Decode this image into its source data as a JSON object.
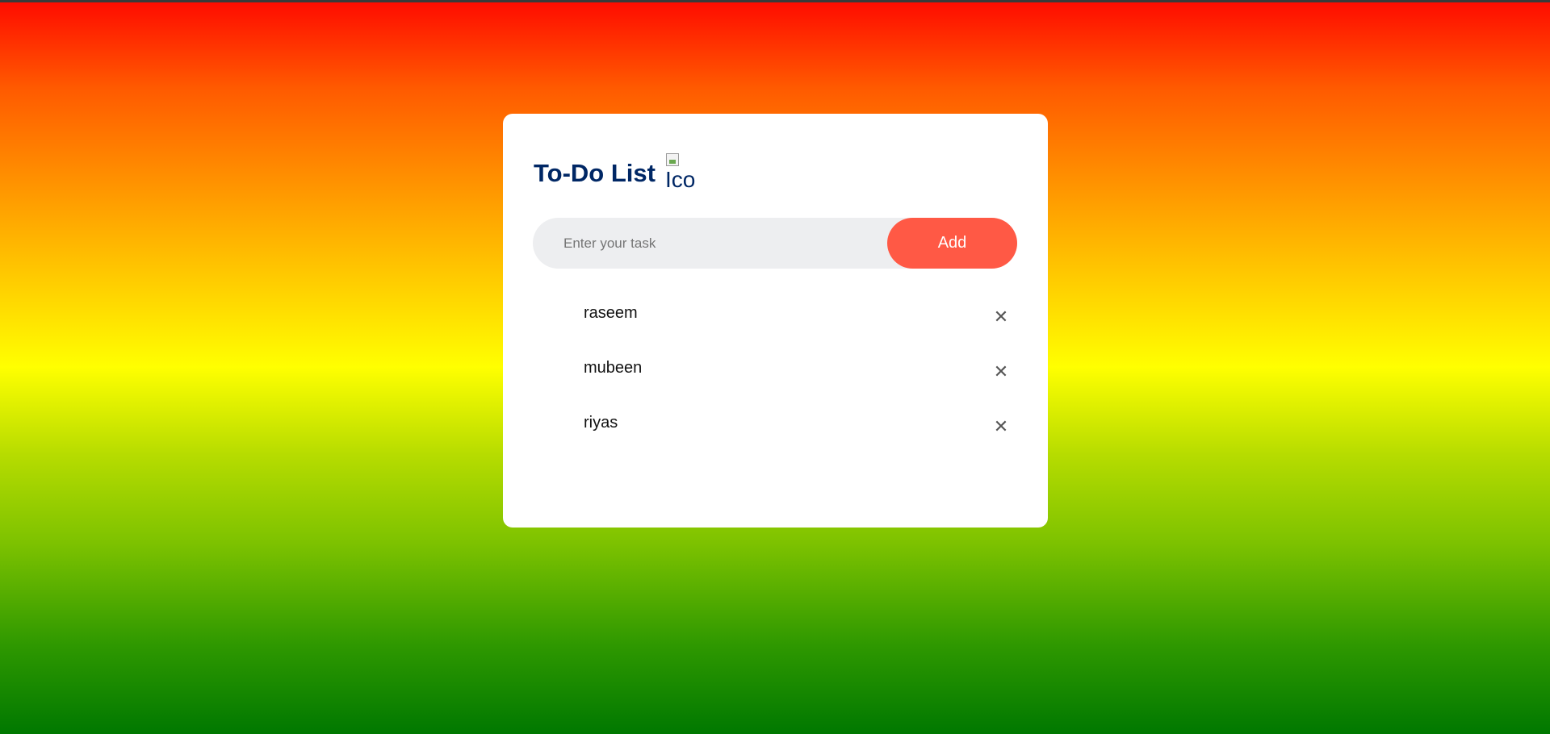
{
  "app": {
    "title": "To-Do List",
    "title_icon": {
      "name": "broken-image-icon",
      "alt_text": "Icon"
    }
  },
  "input": {
    "placeholder": "Enter your task",
    "value": "",
    "add_label": "Add"
  },
  "tasks": [
    {
      "text": "raseem",
      "delete_icon": "✕"
    },
    {
      "text": "mubeen",
      "delete_icon": "✕"
    },
    {
      "text": "riyas",
      "delete_icon": "✕"
    }
  ],
  "colors": {
    "title": "#002765",
    "accent": "#ff5945",
    "input_bg": "#edeef0"
  }
}
